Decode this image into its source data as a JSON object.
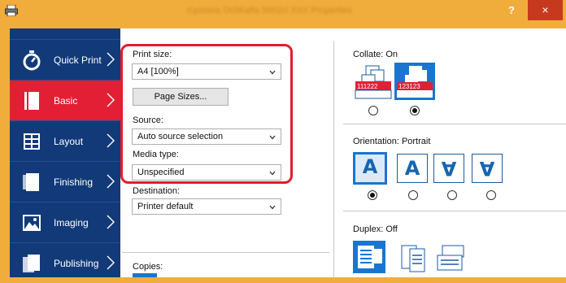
{
  "window": {
    "title": "Kyocera TASKalfa 5052ci XXX Properties",
    "help_label": "?",
    "close_label": "×"
  },
  "sidebar": {
    "items": [
      {
        "label": "Quick Print",
        "icon": "stopwatch-icon",
        "active": false
      },
      {
        "label": "Basic",
        "icon": "document-icon",
        "active": true
      },
      {
        "label": "Layout",
        "icon": "layout-grid-icon",
        "active": false
      },
      {
        "label": "Finishing",
        "icon": "finishing-icon",
        "active": false
      },
      {
        "label": "Imaging",
        "icon": "image-icon",
        "active": false
      },
      {
        "label": "Publishing",
        "icon": "publishing-icon",
        "active": false
      }
    ]
  },
  "basic": {
    "print_size_label": "Print size:",
    "print_size_value": "A4  [100%]",
    "page_sizes_button": "Page Sizes...",
    "source_label": "Source:",
    "source_value": "Auto source selection",
    "media_type_label": "Media type:",
    "media_type_value": "Unspecified",
    "destination_label": "Destination:",
    "destination_value": "Printer default",
    "copies_label": "Copies:"
  },
  "collate": {
    "label": "Collate:",
    "value": "On",
    "option_off_text": "111222",
    "option_on_text": "123123",
    "selected": "on"
  },
  "orientation": {
    "label": "Orientation:",
    "value": "Portrait",
    "options": [
      "A",
      "A",
      "A",
      "A"
    ],
    "selected_index": 0
  },
  "duplex": {
    "label": "Duplex:",
    "value": "Off"
  },
  "colors": {
    "sidebar": "#123a78",
    "active": "#e21f35",
    "accent": "#1a75d0",
    "highlight": "#e31d2b",
    "titlebar": "#f0ad3c"
  }
}
